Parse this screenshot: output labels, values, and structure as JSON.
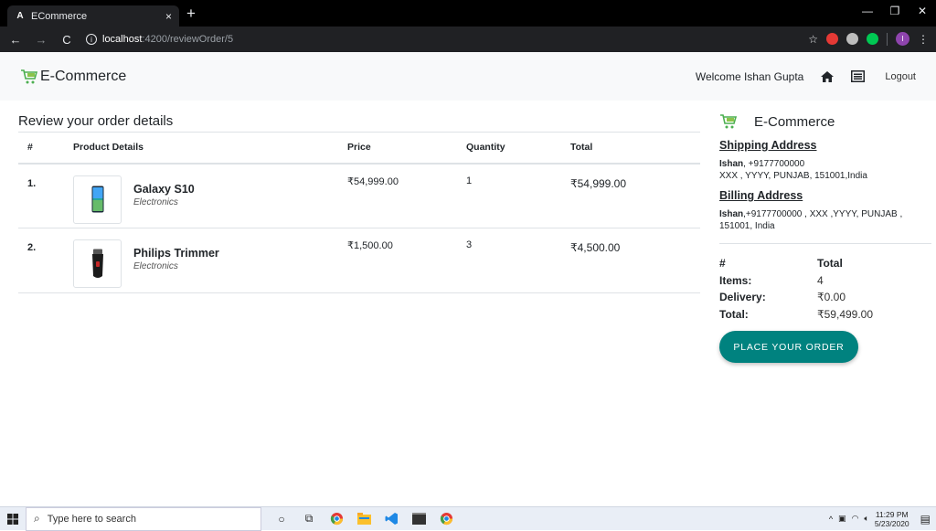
{
  "browser": {
    "tab_title": "ECommerce",
    "tab_favicon": "A",
    "url_host": "localhost",
    "url_path": ":4200/reviewOrder/5",
    "new_tab": "+",
    "close": "×"
  },
  "navbar": {
    "brand": "E-Commerce",
    "welcome": "Welcome Ishan Gupta",
    "logout": "Logout"
  },
  "main": {
    "title": "Review your order details",
    "columns": [
      "#",
      "Product Details",
      "Price",
      "Quantity",
      "Total"
    ],
    "rows": [
      {
        "num": "1.",
        "name": "Galaxy S10",
        "category": "Electronics",
        "price": "₹54,999.00",
        "qty": "1",
        "total": "₹54,999.00"
      },
      {
        "num": "2.",
        "name": "Philips Trimmer",
        "category": "Electronics",
        "price": "₹1,500.00",
        "qty": "3",
        "total": "₹4,500.00"
      }
    ]
  },
  "side": {
    "brand": "E-Commerce",
    "shipping_title": "Shipping Address",
    "shipping_name": "Ishan",
    "shipping_rest": ", +9177700000",
    "shipping_line2": "XXX , YYYY, PUNJAB, 151001,India",
    "billing_title": "Billing Address",
    "billing_name": "Ishan",
    "billing_rest": ",+9177700000 , XXX ,YYYY, PUNJAB , 151001, India",
    "summary": {
      "h_key": "#",
      "h_val": "Total",
      "items_key": "Items:",
      "items_val": "4",
      "delivery_key": "Delivery:",
      "delivery_val": "₹0.00",
      "total_key": "Total:",
      "total_val": "₹59,499.00"
    },
    "order_button": "PLACE YOUR ORDER"
  },
  "taskbar": {
    "search_placeholder": "Type here to search",
    "time": "11:29 PM",
    "date": "5/23/2020"
  },
  "colors": {
    "accent": "#00827f",
    "navbar_bg": "#f8f9fa"
  }
}
